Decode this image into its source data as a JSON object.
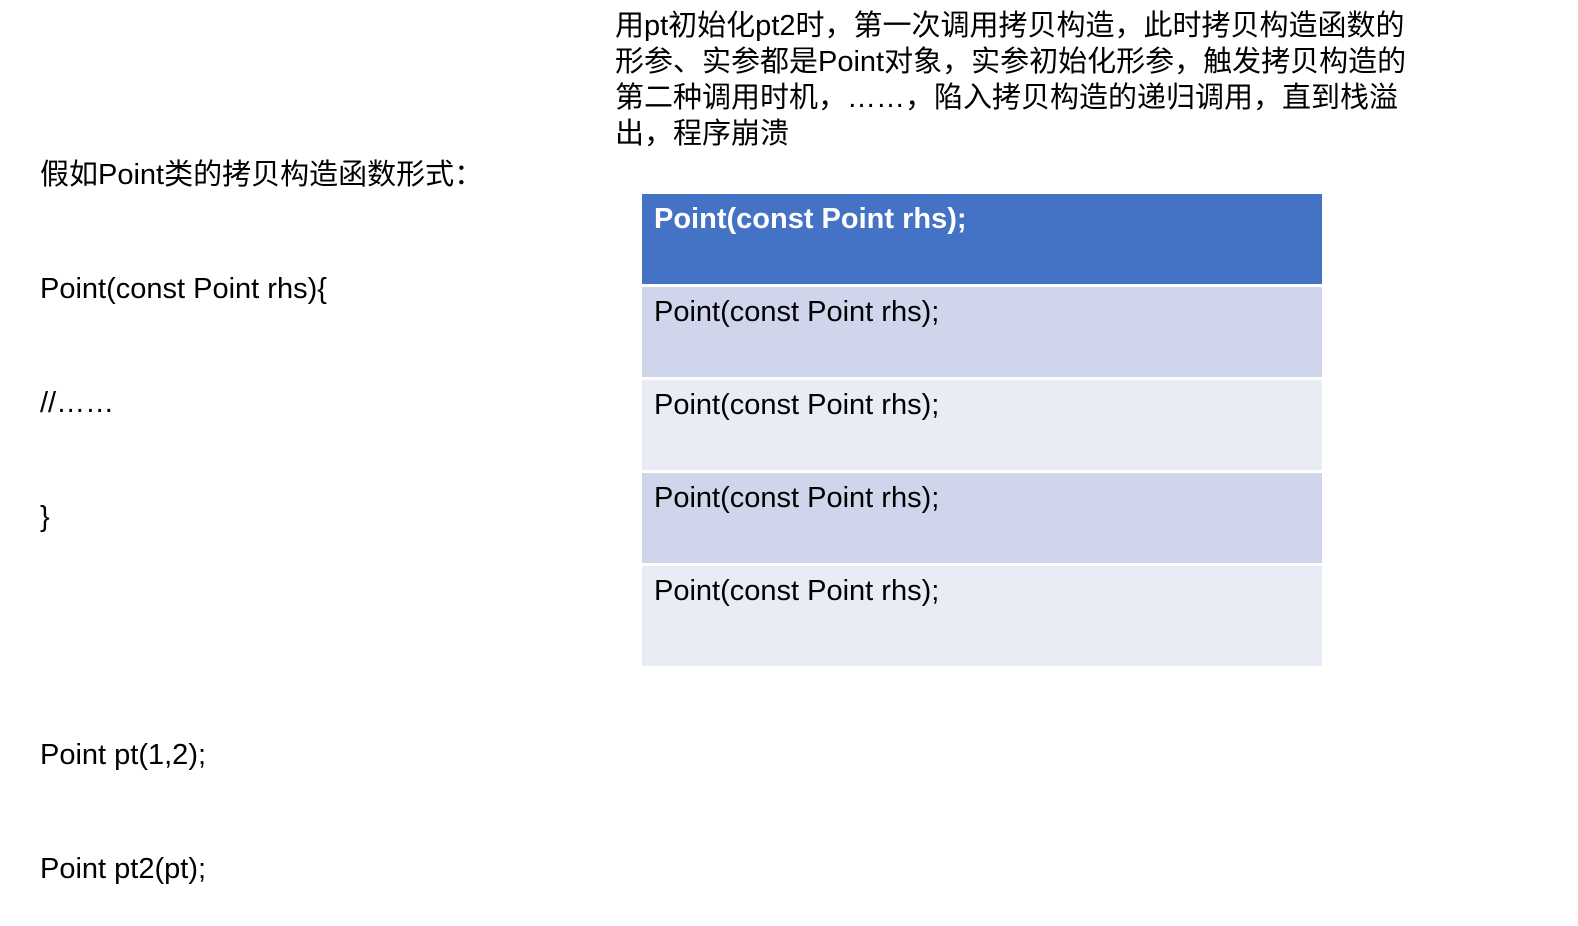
{
  "left": {
    "lines": [
      "假如Point类的拷贝构造函数形式：",
      "Point(const Point rhs){",
      "//……",
      "}"
    ],
    "code": [
      "Point pt(1,2);",
      "Point pt2(pt);"
    ]
  },
  "explanation": {
    "lines": [
      "用pt初始化pt2时，第一次调用拷贝构造，此时拷贝构造函数的",
      "形参、实参都是Point对象，实参初始化形参，触发拷贝构造的",
      "第二种调用时机，……，陷入拷贝构造的递归调用，直到栈溢",
      "出，程序崩溃"
    ]
  },
  "stack": {
    "rows": [
      "Point(const Point rhs);",
      "Point(const Point rhs);",
      "Point(const Point rhs);",
      "Point(const Point rhs);",
      "Point(const Point rhs);"
    ],
    "colors": {
      "header": "#4472c4",
      "band_dark": "#cfd5ea",
      "band_light": "#e9ebf5"
    }
  }
}
